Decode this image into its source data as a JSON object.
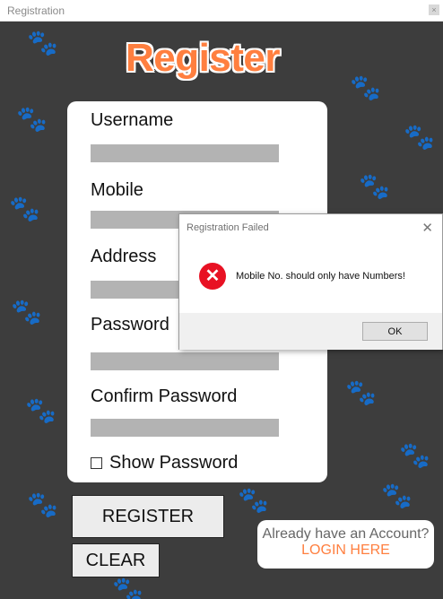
{
  "window": {
    "title": "Registration"
  },
  "heading": "Register",
  "form": {
    "fields": [
      {
        "label": "Username",
        "value": ""
      },
      {
        "label": "Mobile",
        "value": ""
      },
      {
        "label": "Address",
        "value": ""
      },
      {
        "label": "Password",
        "value": ""
      },
      {
        "label": "Confirm Password",
        "value": ""
      }
    ],
    "show_password_label": "Show Password"
  },
  "buttons": {
    "register": "REGISTER",
    "clear": "CLEAR"
  },
  "login": {
    "question": "Already have an Account?",
    "link": "LOGIN HERE"
  },
  "dialog": {
    "title": "Registration Failed",
    "message": "Mobile No. should only have Numbers!",
    "ok": "OK",
    "icon": "error-icon"
  },
  "colors": {
    "accent": "#ff7f3f",
    "background": "#3d3d3d",
    "error": "#e81123"
  }
}
